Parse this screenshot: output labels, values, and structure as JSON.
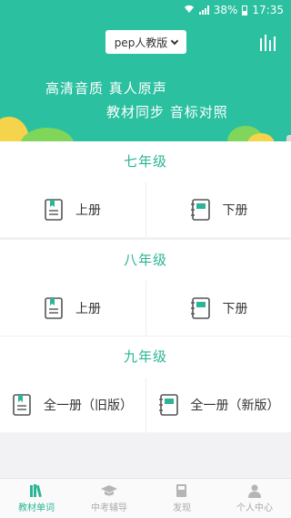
{
  "status_bar": {
    "battery": "38%",
    "time": "17:35"
  },
  "header": {
    "edition_label": "pep人教版",
    "slogan_line1": "高清音质 真人原声",
    "slogan_line2": "教材同步 音标对照"
  },
  "grades": [
    {
      "title": "七年级",
      "left_label": "上册",
      "right_label": "下册"
    },
    {
      "title": "八年级",
      "left_label": "上册",
      "right_label": "下册"
    },
    {
      "title": "九年级",
      "left_label": "全一册（旧版）",
      "right_label": "全一册（新版）"
    }
  ],
  "tabbar": {
    "tabs": [
      {
        "label": "教材单词",
        "icon": "books-icon",
        "active": true
      },
      {
        "label": "中考辅导",
        "icon": "graduation-cap-icon",
        "active": false
      },
      {
        "label": "发现",
        "icon": "discover-book-icon",
        "active": false
      },
      {
        "label": "个人中心",
        "icon": "user-icon",
        "active": false
      }
    ]
  },
  "colors": {
    "accent": "#2bc0a0",
    "accent_text": "#2bb596",
    "inactive": "#aaaaaa"
  }
}
